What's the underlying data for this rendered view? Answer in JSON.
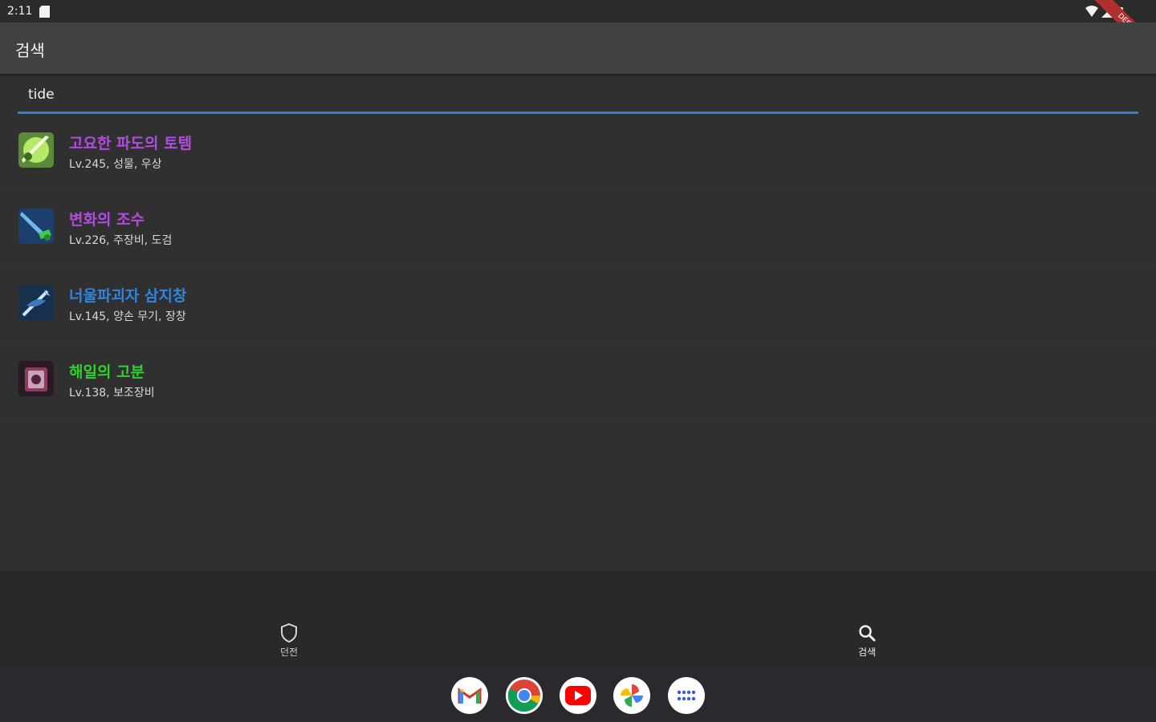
{
  "status_bar": {
    "time": "2:11",
    "debug_label": "DEBUG"
  },
  "app_bar": {
    "title": "검색"
  },
  "search": {
    "value": "tide",
    "placeholder": ""
  },
  "results": [
    {
      "name": "고요한 파도의 토템",
      "subtitle": "Lv.245, 성물, 우상",
      "color": "#b14be0",
      "icon": "totem-icon"
    },
    {
      "name": "변화의 조수",
      "subtitle": "Lv.226, 주장비, 도검",
      "color": "#b14be0",
      "icon": "sword-icon"
    },
    {
      "name": "너울파괴자 삼지창",
      "subtitle": "Lv.145, 양손 무기, 장창",
      "color": "#2f86e0",
      "icon": "trident-icon"
    },
    {
      "name": "해일의 고분",
      "subtitle": "Lv.138, 보조장비",
      "color": "#2ed12e",
      "icon": "tome-icon"
    }
  ],
  "bottom_nav": {
    "items": [
      {
        "label": "던전",
        "icon": "shield-icon"
      },
      {
        "label": "검색",
        "icon": "search-icon"
      }
    ]
  },
  "dock": {
    "apps": [
      {
        "name": "Gmail",
        "icon": "gmail-icon"
      },
      {
        "name": "Chrome",
        "icon": "chrome-icon"
      },
      {
        "name": "YouTube",
        "icon": "youtube-icon"
      },
      {
        "name": "Photos",
        "icon": "photos-icon"
      },
      {
        "name": "All apps",
        "icon": "app-drawer-icon"
      }
    ]
  },
  "colors": {
    "accent": "#2f7fd6",
    "background": "#303030",
    "app_bar": "#424242",
    "epic": "#b14be0",
    "rare": "#2f86e0",
    "uncommon": "#2ed12e"
  }
}
